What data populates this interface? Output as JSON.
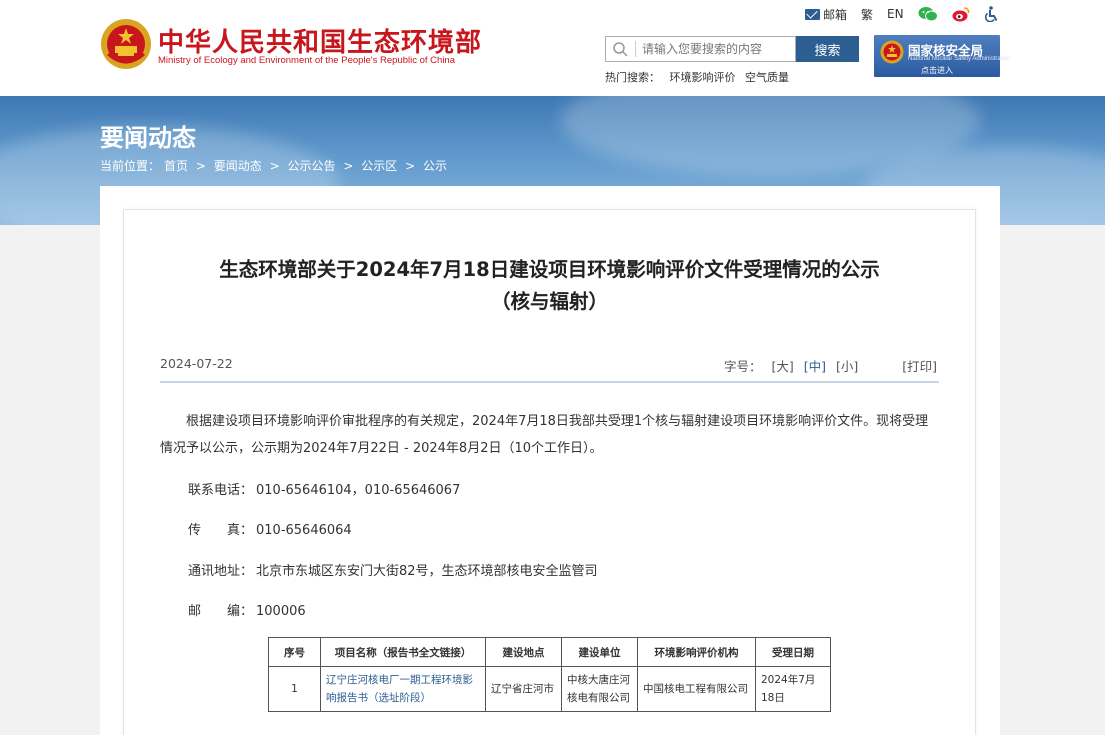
{
  "site": {
    "name_cn": "中华人民共和国生态环境部",
    "name_en": "Ministry of Ecology and Environment of the People's Republic of China"
  },
  "top_links": {
    "mail": "邮箱",
    "traditional": "繁",
    "english": "EN"
  },
  "search": {
    "placeholder": "请输入您要搜索的内容",
    "button": "搜索",
    "hot_label": "热门搜索：",
    "hot_terms": [
      "环境影响评价",
      "空气质量"
    ]
  },
  "nnsa": {
    "name": "国家核安全局",
    "name_en": "National Nuclear Safety Administration",
    "enter": "点击进入"
  },
  "banner": {
    "title": "要闻动态",
    "breadcrumb_prefix": "当前位置：",
    "crumbs": [
      "首页",
      ">",
      "要闻动态",
      ">",
      "公示公告",
      ">",
      "公示区",
      ">",
      "公示"
    ]
  },
  "article": {
    "title_line1": "生态环境部关于2024年7月18日建设项目环境影响评价文件受理情况的公示",
    "title_line2": "（核与辐射）",
    "date": "2024-07-22",
    "font_label": "字号：",
    "font_large": "[大]",
    "font_medium": "[中]",
    "font_small": "[小]",
    "print": "[打印]",
    "paragraph": "根据建设项目环境影响评价审批程序的有关规定，2024年7月18日我部共受理1个核与辐射建设项目环境影响评价文件。现将受理情况予以公示，公示期为2024年7月22日 - 2024年8月2日（10个工作日）。",
    "contacts": [
      {
        "label": "联系电话：",
        "value": "010-65646104，010-65646067"
      },
      {
        "label": "传　　真：",
        "value": "010-65646064"
      },
      {
        "label": "通讯地址：",
        "value": "北京市东城区东安门大街82号，生态环境部核电安全监管司"
      },
      {
        "label": "邮　　编：",
        "value": "100006"
      }
    ],
    "table": {
      "headers": [
        "序号",
        "项目名称（报告书全文链接）",
        "建设地点",
        "建设单位",
        "环境影响评价机构",
        "受理日期"
      ],
      "rows": [
        [
          "1",
          "辽宁庄河核电厂一期工程环境影响报告书（选址阶段）",
          "辽宁省庄河市",
          "中核大唐庄河核电有限公司",
          "中国核电工程有限公司",
          "2024年7月18日"
        ]
      ]
    }
  },
  "colors": {
    "brand_red": "#c8161d",
    "accent_blue": "#2d5e91"
  }
}
